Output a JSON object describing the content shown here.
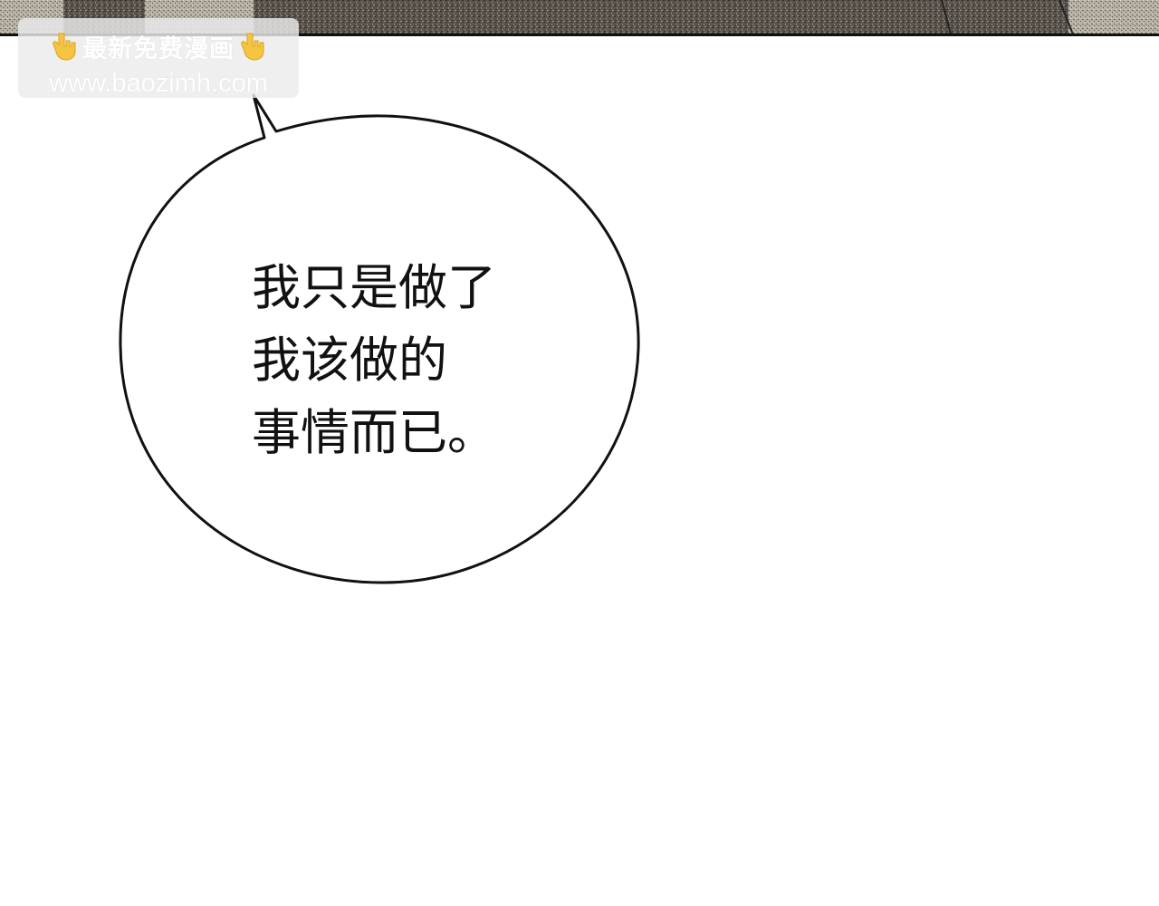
{
  "watermark": {
    "title": "最新免费漫画",
    "url": "www.baozimh.com",
    "left_icon": "pointing-down-hand-icon",
    "right_icon": "pointing-down-hand-icon"
  },
  "dialogue": {
    "lines": [
      "我只是做了",
      "我该做的",
      "事情而已。"
    ]
  },
  "colors": {
    "background": "#ffffff",
    "outline": "#111111",
    "strip_dark": "#4a4540",
    "strip_light": "#9c9589",
    "hand": "#f5c542",
    "watermark_bg": "#ebebeb"
  }
}
